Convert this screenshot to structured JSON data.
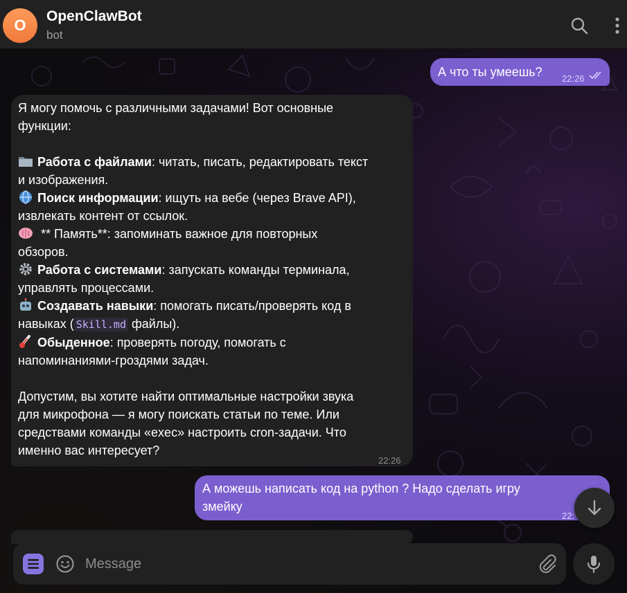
{
  "header": {
    "avatar_letter": "O",
    "title": "OpenClawBot",
    "subtitle": "bot",
    "icons": [
      "search-icon",
      "more-vertical-icon"
    ]
  },
  "colors": {
    "outgoing_bubble": "#7b5fcf",
    "incoming_bubble": "#212121",
    "accent": "#8774e1",
    "avatar": "#f08a4b"
  },
  "messages": {
    "m1": {
      "text": "А что ты умеешь?",
      "time": "22:26"
    },
    "m2": {
      "intro_1": "Я могу помочь с различными задачами! Вот основные",
      "intro_2": "функции:",
      "item1_bold": "Работа с файлами",
      "item1_rest": ": читать, писать, редактировать текст",
      "item1_line2": "и изображения.",
      "item2_bold": "Поиск информации",
      "item2_rest": ": ищуть на вебе (через Brave API),",
      "item2_line2": "извлекать контент от ссылок.",
      "item3_text": " ** Память**: запоминать важное для повторных",
      "item3_line2": "обзоров.",
      "item4_bold": "Работа с системами",
      "item4_rest": ": запускать команды терминала,",
      "item4_line2": "управлять процессами.",
      "item5_bold": "Создавать навыки",
      "item5_rest": ": помогать писать/проверять код в",
      "item5_line2_pre": "навыках (",
      "item5_code": "Skill.md",
      "item5_line2_post": " файлы).",
      "item6_bold": "Обыденное",
      "item6_rest": ": проверять погоду, помогать с",
      "item6_line2": "напоминаниями-гроздями задач.",
      "outro_1": "Допустим, вы хотите найти оптимальные настройки звука",
      "outro_2": "для микрофона — я могу поискать статьи по теме. Или",
      "outro_3": "средствами команды «exec» настроить cron-задачи. Что",
      "outro_4": "именно вас интересует?",
      "time": "22:26"
    },
    "m3": {
      "line1": "А можешь написать код на python ? Надо сделать игру",
      "line2": "змейку",
      "time": "22:"
    }
  },
  "composer": {
    "placeholder": "Message",
    "icons": [
      "menu-icon",
      "emoji-icon",
      "attach-icon",
      "mic-icon"
    ]
  },
  "scroll_button_icon": "arrow-down-icon"
}
